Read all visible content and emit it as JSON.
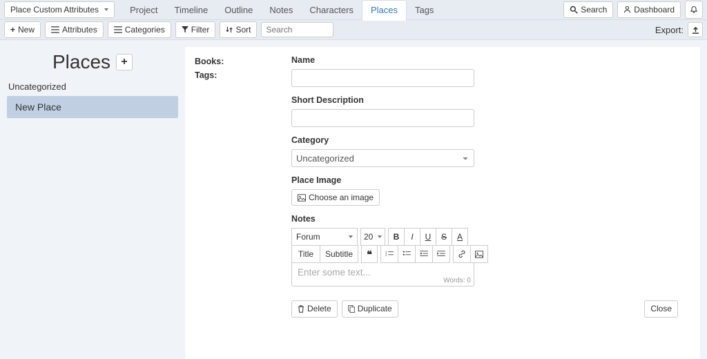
{
  "topbar": {
    "custom_attr_label": "Place Custom Attributes",
    "tabs": [
      "Project",
      "Timeline",
      "Outline",
      "Notes",
      "Characters",
      "Places",
      "Tags"
    ],
    "active_tab": "Places",
    "search_btn": "Search",
    "dashboard_btn": "Dashboard"
  },
  "toolbar": {
    "new_btn": "New",
    "attributes_btn": "Attributes",
    "categories_btn": "Categories",
    "filter_btn": "Filter",
    "sort_btn": "Sort",
    "search_placeholder": "Search",
    "export_label": "Export:"
  },
  "sidebar": {
    "title": "Places",
    "category": "Uncategorized",
    "items": [
      "New Place"
    ]
  },
  "meta": {
    "books_label": "Books:",
    "tags_label": "Tags:"
  },
  "form": {
    "name_label": "Name",
    "short_desc_label": "Short Description",
    "category_label": "Category",
    "category_value": "Uncategorized",
    "image_label": "Place Image",
    "choose_image_btn": "Choose an image",
    "notes_label": "Notes",
    "editor": {
      "font": "Forum",
      "size": "20",
      "title_btn": "Title",
      "subtitle_btn": "Subtitle",
      "placeholder": "Enter some text...",
      "words_label": "Words: 0"
    },
    "delete_btn": "Delete",
    "duplicate_btn": "Duplicate",
    "close_btn": "Close"
  }
}
